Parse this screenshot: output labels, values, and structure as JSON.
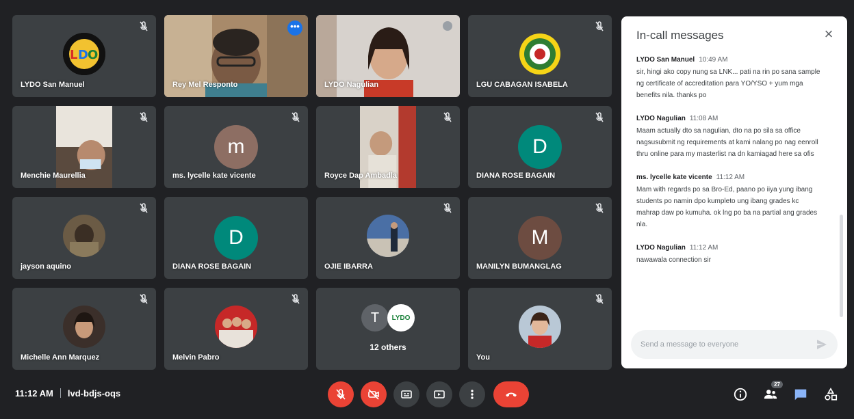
{
  "tiles": [
    {
      "name": "LYDO San Manuel"
    },
    {
      "name": "Rey Mel Responto"
    },
    {
      "name": "LYDO Nagulian"
    },
    {
      "name": "LGU CABAGAN ISABELA"
    },
    {
      "name": "Menchie Maurellia"
    },
    {
      "name": "ms. lycelle kate vicente",
      "initial": "m",
      "color": "#8d6e63"
    },
    {
      "name": "Royce Dap Ambadla"
    },
    {
      "name": "DIANA ROSE BAGAIN",
      "initial": "D",
      "color": "#00897b"
    },
    {
      "name": "jayson aquino"
    },
    {
      "name": "DIANA ROSE BAGAIN",
      "initial": "D",
      "color": "#00897b"
    },
    {
      "name": "OJIE IBARRA"
    },
    {
      "name": "MANILYN BUMANGLAG",
      "initial": "M",
      "color": "#6d4c41"
    },
    {
      "name": "Michelle Ann Marquez"
    },
    {
      "name": "Melvin Pabro"
    },
    {
      "name": "12 others",
      "initial_t": "T",
      "logo_text": "LYDO"
    },
    {
      "name": "You"
    }
  ],
  "chat": {
    "title": "In-call messages",
    "placeholder": "Send a message to everyone",
    "messages": [
      {
        "sender": "LYDO San Manuel",
        "time": "10:49 AM",
        "text": "sir, hingi ako copy nung sa LNK... pati na rin po sana sample ng certificate of accreditation para YO/YSO + yum mga benefits nila. thanks po"
      },
      {
        "sender": "LYDO Nagulian",
        "time": "11:08 AM",
        "text": "Maam actually dto sa nagulian, dto na po sila sa office nagsusubmit ng requirements at kami nalang po nag eenroll thru online para my masterlist na dn kamiagad here sa ofis"
      },
      {
        "sender": "ms. lycelle kate vicente",
        "time": "11:12 AM",
        "text": "Mam with regards po sa Bro-Ed, paano po iiya yung ibang students po namin dpo kumpleto ung ibang grades kc mahrap daw po kumuha. ok lng po ba na partial ang grades nla."
      },
      {
        "sender": "LYDO Nagulian",
        "time": "11:12 AM",
        "text": "nawawala connection sir"
      }
    ]
  },
  "meeting": {
    "time": "11:12 AM",
    "code": "lvd-bdjs-oqs"
  },
  "participants_count": "27",
  "colors": {
    "end_call": "#ea4335",
    "panel_bg": "#ffffff",
    "tile_bg": "#3c4043",
    "accent": "#1a73e8"
  }
}
